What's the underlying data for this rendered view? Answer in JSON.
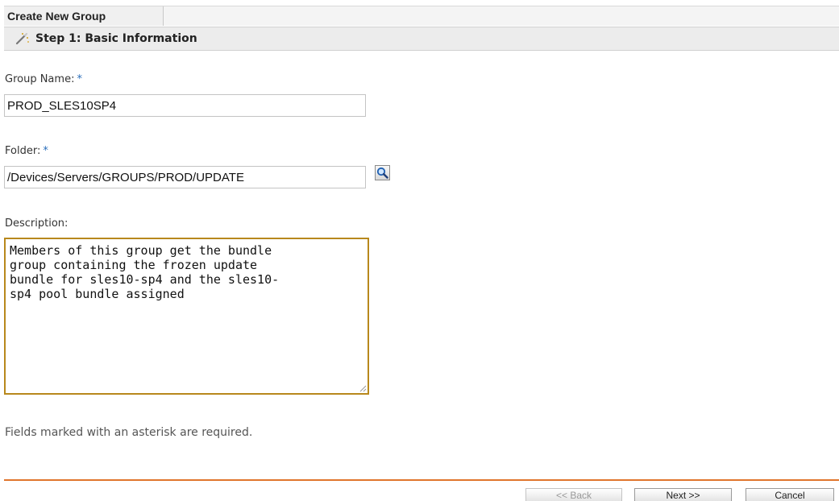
{
  "tab": {
    "label": "Create New Group"
  },
  "step": {
    "title": "Step 1: Basic Information",
    "icon": "wand-icon"
  },
  "group_name": {
    "label": "Group Name:",
    "required_mark": "*",
    "value": "PROD_SLES10SP4"
  },
  "folder": {
    "label": "Folder:",
    "required_mark": "*",
    "value": "/Devices/Servers/GROUPS/PROD/UPDATE",
    "browse_icon": "magnifier-icon"
  },
  "description": {
    "label": "Description:",
    "lines": [
      "Members of this group get the bundle",
      "group containing the frozen update",
      "bundle for sles10-sp4 and the sles10-",
      "sp4 pool bundle assigned"
    ]
  },
  "hint": "Fields marked with an asterisk are required.",
  "buttons": {
    "back": "<< Back",
    "next": "Next >>",
    "cancel": "Cancel"
  },
  "colors": {
    "accent_divider": "#e0752c",
    "required_mark": "#2a6ebb",
    "focus_border": "#b8881c"
  }
}
